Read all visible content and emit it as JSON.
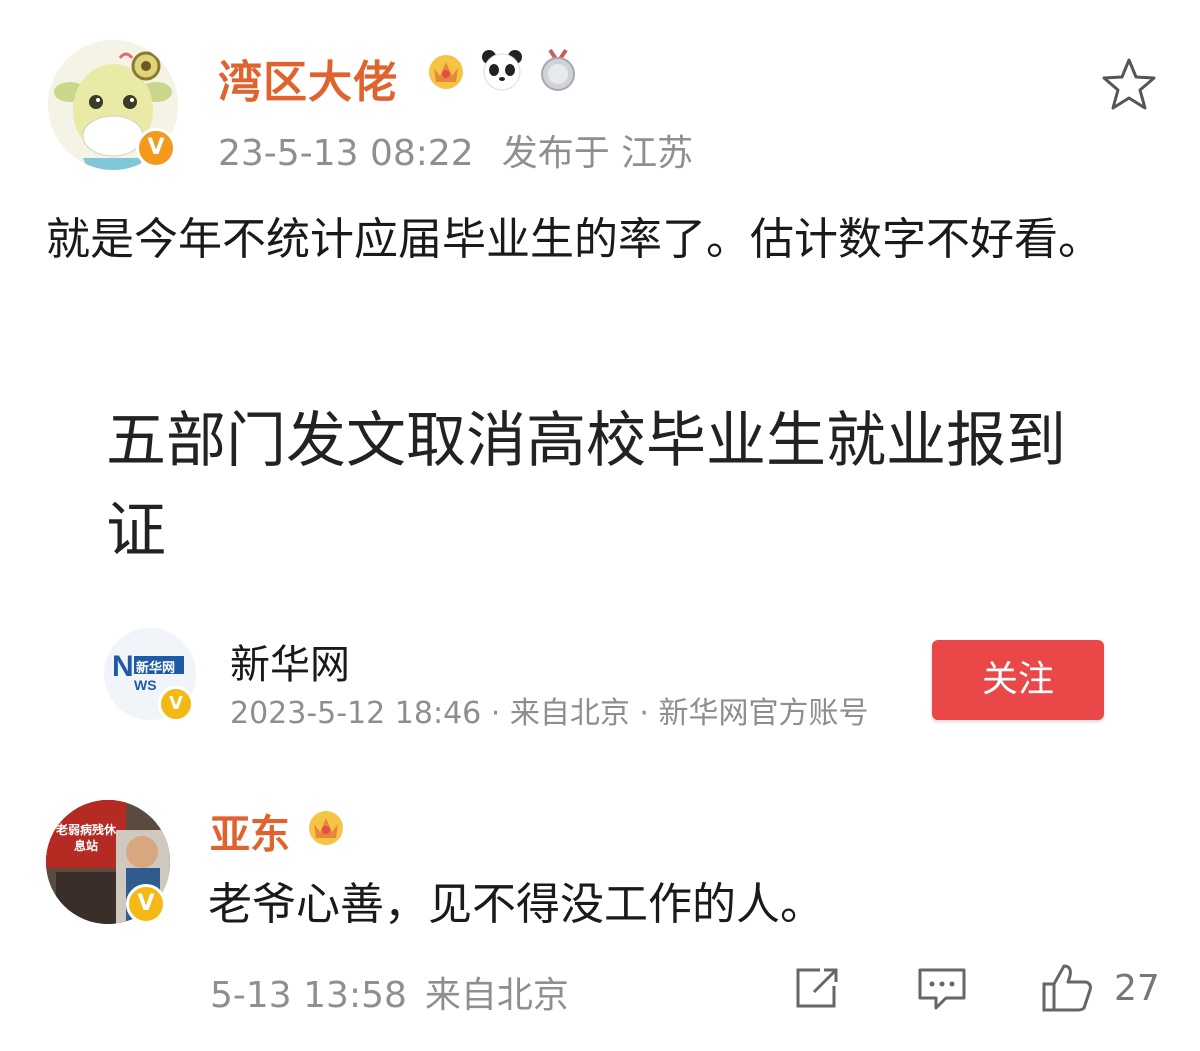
{
  "post": {
    "author": "湾区大佬",
    "date": "23-5-13 08:22",
    "location": "发布于 江苏",
    "badges": [
      "crown-icon",
      "panda-icon",
      "medal-icon"
    ],
    "text": "就是今年不统计应届毕业生的率了。估计数字不好看。"
  },
  "shared": {
    "headline": "五部门发文取消高校毕业生就业报到证",
    "source_logo_text": "新华网",
    "source_name": "新华网",
    "source_meta": "2023-5-12 18:46 · 来自北京 · 新华网官方账号",
    "follow_label": "关注"
  },
  "comment": {
    "author": "亚东",
    "avatar_sign": "老弱病残休息站",
    "text": "老爷心善，见不得没工作的人。",
    "date": "5-13 13:58",
    "source": "来自北京",
    "likes": "27"
  },
  "colors": {
    "name": "#e0622d",
    "follow": "#ea4748",
    "meta": "#8f8f8f",
    "verified": "#f39a1d"
  }
}
